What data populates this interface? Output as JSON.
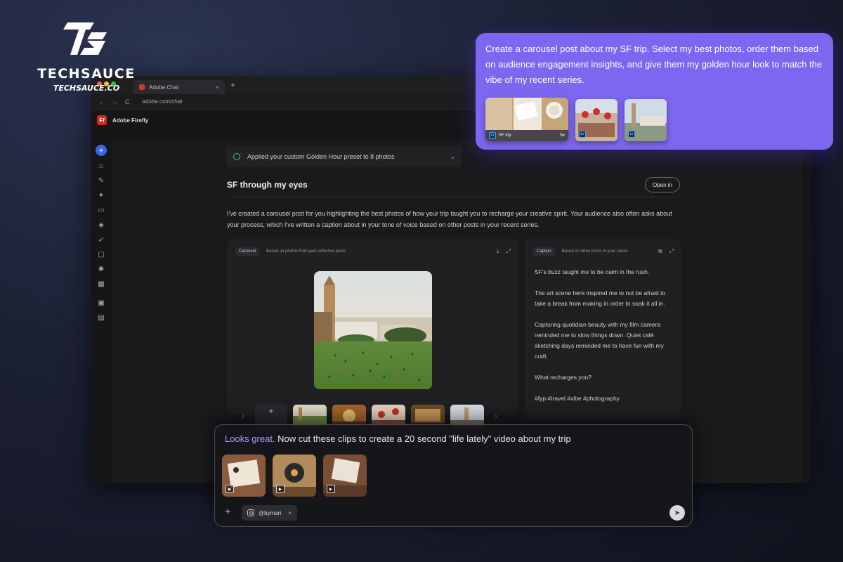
{
  "brand": {
    "name": "TECHSAUCE",
    "url": "TECHSAUCE.CO"
  },
  "browser": {
    "tab_title": "Adobe Chat",
    "tab_close": "×",
    "new_tab": "+",
    "nav_back": "←",
    "nav_forward": "→",
    "reload": "C",
    "url": "adobe.com/chat"
  },
  "app": {
    "logo_glyph": "Ff",
    "title": "Adobe Firefly"
  },
  "sidebar": {
    "new_label": "+",
    "items": [
      {
        "name": "home-icon",
        "glyph": "⌂"
      },
      {
        "name": "edit-icon",
        "glyph": "✎"
      },
      {
        "name": "sparkle-icon",
        "glyph": "✦"
      },
      {
        "name": "chat-icon",
        "glyph": "▭"
      },
      {
        "name": "tag-icon",
        "glyph": "◈"
      },
      {
        "name": "rocket-icon",
        "glyph": "➶"
      },
      {
        "name": "folder-icon",
        "glyph": "▢"
      },
      {
        "name": "settings-icon",
        "glyph": "✺"
      },
      {
        "name": "grid-icon",
        "glyph": "▦"
      },
      {
        "name": "photoshop-icon",
        "glyph": "▣"
      },
      {
        "name": "image-icon",
        "glyph": "▤"
      }
    ]
  },
  "status": {
    "applied_text": "Applied your custom Golden Hour preset to 8 photos",
    "chevron": "⌄"
  },
  "result": {
    "title": "SF through my eyes",
    "open_button": "Open in",
    "description": "I've created a carousel post for you highlighting the best photos of how your trip taught you to recharge your creative spirit. Your audience also often asks about your process, which I've written a caption about in your tone of voice based on other posts in your recent series."
  },
  "carousel": {
    "chip": "Carousel",
    "subtitle": "Based on photos from past reflective posts",
    "download_icon": "⤓",
    "expand_icon": "⤢",
    "add_label": "+",
    "prev": "‹",
    "next": "›"
  },
  "caption": {
    "chip": "Caption",
    "subtitle": "Based on other posts in your series",
    "copy_icon": "⧉",
    "expand_icon": "⤢",
    "paragraphs": [
      "SF's buzz taught me to be calm in the rush.",
      "The art scene here inspired me to not be afraid to take a break from making in order to soak it all in.",
      "Capturing quotidian beauty with my film camera reminded me to slow things down. Quiet café sketching days reminded me to have fun with my craft.",
      "What recharges you?",
      "#fyp #travel #vibe #photography"
    ]
  },
  "bubble": {
    "text": "Create a carousel post about my SF trip. Select my best photos, order them based on audience engagement insights, and give them my golden hour look to match the vibe of my recent series.",
    "album_label": "SF trip",
    "album_count": "5e",
    "lr_badge": "Lr"
  },
  "chat_input": {
    "accent_text": "Looks great.",
    "rest_text": " Now cut these clips to create a 20 second \"life lately\" video about my trip",
    "add_label": "+",
    "account": "@bymari",
    "remove": "×",
    "send_icon": "➤",
    "play_icon": "▶"
  },
  "colors": {
    "accent": "#7d67f0",
    "firefly_red": "#d7261e",
    "primary_blue": "#3b63f0",
    "check_green": "#3cc27a"
  }
}
